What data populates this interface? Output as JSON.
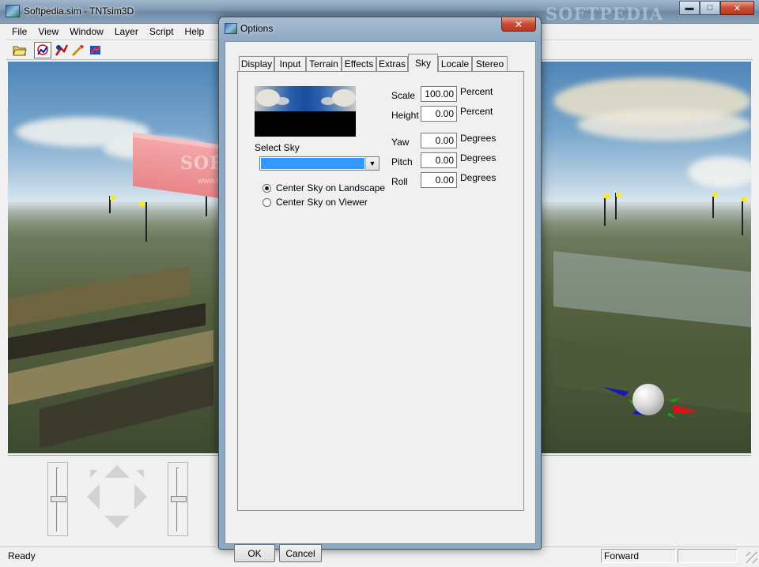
{
  "main_window": {
    "title": "Softpedia.sim - TNTsim3D",
    "watermark": "SOFTPEDIA",
    "controls": {
      "minimize": "▬",
      "maximize": "□",
      "close": "✕"
    },
    "menu": [
      "File",
      "View",
      "Window",
      "Layer",
      "Script",
      "Help"
    ],
    "toolbar_icons": [
      "open-folder-icon",
      "pointer-tool-icon",
      "camera-target-icon",
      "path-tool-icon",
      "measure-tool-icon"
    ]
  },
  "viewport": {
    "watermark": "SOFTPEDIA",
    "watermark_url": "www.softpedia.com"
  },
  "status_bar": {
    "text": "Ready",
    "mode": "Forward"
  },
  "dialog": {
    "title": "Options",
    "close": "✕",
    "tabs": [
      "Display",
      "Input",
      "Terrain",
      "Effects",
      "Extras",
      "Sky",
      "Locale",
      "Stereo"
    ],
    "active_tab": "Sky",
    "sky": {
      "select_sky_label": "Select Sky",
      "select_sky_value": "",
      "center_options": [
        "Center Sky on Landscape",
        "Center Sky on Viewer"
      ],
      "center_selected": "Center Sky on Landscape",
      "fields": [
        {
          "label": "Scale",
          "value": "100.00",
          "unit": "Percent"
        },
        {
          "label": "Height",
          "value": "0.00",
          "unit": "Percent"
        },
        {
          "label": "Yaw",
          "value": "0.00",
          "unit": "Degrees"
        },
        {
          "label": "Pitch",
          "value": "0.00",
          "unit": "Degrees"
        },
        {
          "label": "Roll",
          "value": "0.00",
          "unit": "Degrees"
        }
      ]
    },
    "buttons": {
      "ok": "OK",
      "cancel": "Cancel"
    }
  },
  "colors": {
    "selection": "#3399ff",
    "close_button": "#c84a32",
    "titlebar": "#8ea8c1"
  }
}
